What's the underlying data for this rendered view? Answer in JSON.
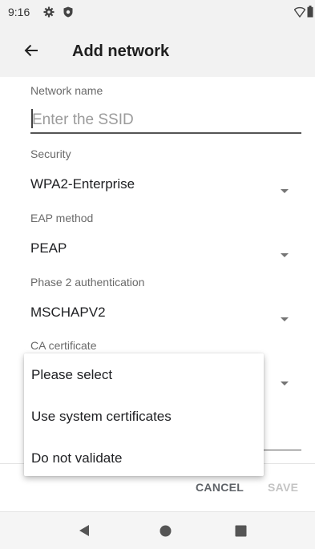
{
  "status_bar": {
    "time": "9:16",
    "icons": [
      "gear-icon",
      "shield-icon",
      "wifi-icon",
      "battery-icon"
    ]
  },
  "app_bar": {
    "title": "Add network",
    "back_icon": "arrow-left-icon"
  },
  "form": {
    "network_name": {
      "label": "Network name",
      "value": "",
      "placeholder": "Enter the SSID"
    },
    "security": {
      "label": "Security",
      "value": "WPA2-Enterprise"
    },
    "eap_method": {
      "label": "EAP method",
      "value": "PEAP"
    },
    "phase2": {
      "label": "Phase 2 authentication",
      "value": "MSCHAPV2"
    },
    "ca_certificate": {
      "label": "CA certificate"
    }
  },
  "dropdown": {
    "options": [
      {
        "label": "Please select"
      },
      {
        "label": "Use system certificates"
      },
      {
        "label": "Do not validate"
      }
    ]
  },
  "actions": {
    "cancel_label": "CANCEL",
    "save_label": "SAVE"
  },
  "nav_bar": {
    "icons": [
      "nav-back-icon",
      "nav-home-icon",
      "nav-recents-icon"
    ]
  },
  "colors": {
    "bar_background": "#f2f2f2",
    "label_gray": "#6a6a6a",
    "disabled_gray": "#c4c4c4"
  }
}
